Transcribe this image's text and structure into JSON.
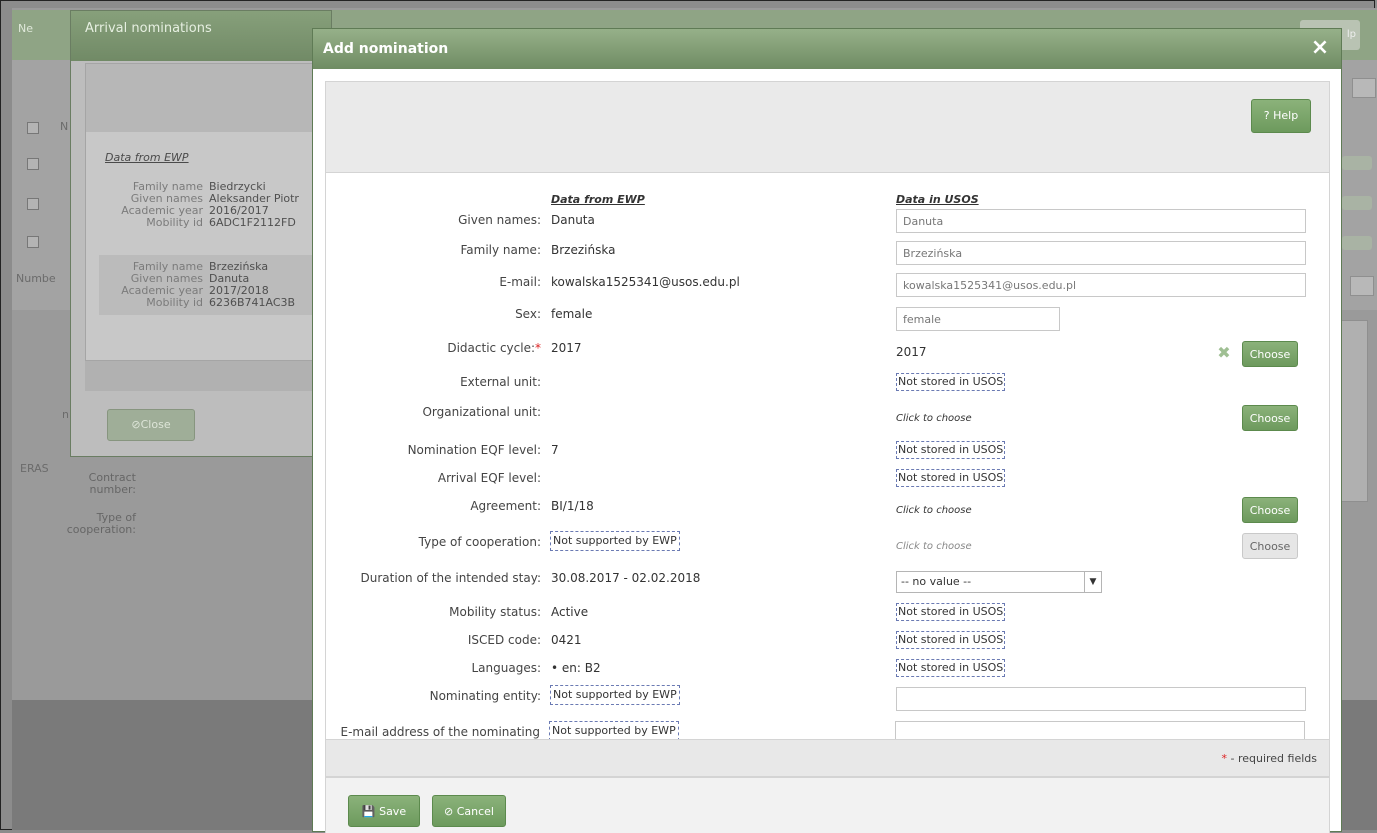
{
  "background": {
    "tab_label": "Ne",
    "right_button": "lp",
    "side_labels": [
      "N",
      "Numbe",
      "n",
      "ERAS"
    ],
    "contract_number_label": "Contract number:",
    "type_of_cooperation_label": "Type of cooperation:"
  },
  "arrival_window": {
    "title": "Arrival nominations",
    "data_label": "Data from EWP",
    "records": [
      {
        "family_name_label": "Family name",
        "family_name": "Biedrzycki",
        "given_names_label": "Given names",
        "given_names": "Aleksander Piotr",
        "academic_year_label": "Academic year",
        "academic_year": "2016/2017",
        "mobility_id_label": "Mobility id",
        "mobility_id": "6ADC1F2112FD"
      },
      {
        "family_name_label": "Family name",
        "family_name": "Brzezińska",
        "given_names_label": "Given names",
        "given_names": "Danuta",
        "academic_year_label": "Academic year",
        "academic_year": "2017/2018",
        "mobility_id_label": "Mobility id",
        "mobility_id": "6236B741AC3B"
      }
    ],
    "close_label": "⊘Close"
  },
  "modal": {
    "title": "Add nomination",
    "close_icon": "×",
    "help_label": "? Help",
    "headers": {
      "ewp": "Data from EWP",
      "usos": "Data in USOS"
    },
    "fields": {
      "given_names": {
        "label": "Given names:",
        "ewp": "Danuta",
        "usos": "Danuta"
      },
      "family_name": {
        "label": "Family name:",
        "ewp": "Brzezińska",
        "usos": "Brzezińska"
      },
      "email": {
        "label": "E-mail:",
        "ewp": "kowalska1525341@usos.edu.pl",
        "usos": "kowalska1525341@usos.edu.pl"
      },
      "sex": {
        "label": "Sex:",
        "ewp": "female",
        "usos": "female"
      },
      "didactic_cycle": {
        "label": "Didactic cycle:",
        "required_mark": "*",
        "ewp": "2017",
        "usos": "2017",
        "choose": "Choose",
        "remove_icon": "✖"
      },
      "external_unit": {
        "label": "External unit:",
        "usos": "Not stored in USOS"
      },
      "organizational_unit": {
        "label": "Organizational unit:",
        "usos": "Click to choose",
        "choose": "Choose"
      },
      "nomination_eqf": {
        "label": "Nomination EQF level:",
        "ewp": "7",
        "usos": "Not stored in USOS"
      },
      "arrival_eqf": {
        "label": "Arrival EQF level:",
        "usos": "Not stored in USOS"
      },
      "agreement": {
        "label": "Agreement:",
        "ewp": "BI/1/18",
        "usos": "Click to choose",
        "choose": "Choose"
      },
      "type_of_cooperation": {
        "label": "Type of cooperation:",
        "ewp": "Not supported by EWP",
        "usos": "Click to choose",
        "choose": "Choose"
      },
      "duration": {
        "label": "Duration of the intended stay:",
        "ewp": "30.08.2017 - 02.02.2018",
        "usos": "-- no value --",
        "arrow": "▼"
      },
      "mobility_status": {
        "label": "Mobility status:",
        "ewp": "Active",
        "usos": "Not stored in USOS"
      },
      "isced": {
        "label": "ISCED code:",
        "ewp": "0421",
        "usos": "Not stored in USOS"
      },
      "languages": {
        "label": "Languages:",
        "ewp": "• en: B2",
        "usos": "Not stored in USOS"
      },
      "nominating_entity": {
        "label": "Nominating entity:",
        "ewp": "Not supported by EWP",
        "usos": ""
      },
      "nominating_email": {
        "label": "E-mail address of the nominating entity:",
        "ewp": "Not supported by EWP",
        "usos": ""
      }
    },
    "required_note_mark": "*",
    "required_note": " - required fields",
    "save_label": "💾 Save",
    "cancel_label": "⊘ Cancel"
  }
}
